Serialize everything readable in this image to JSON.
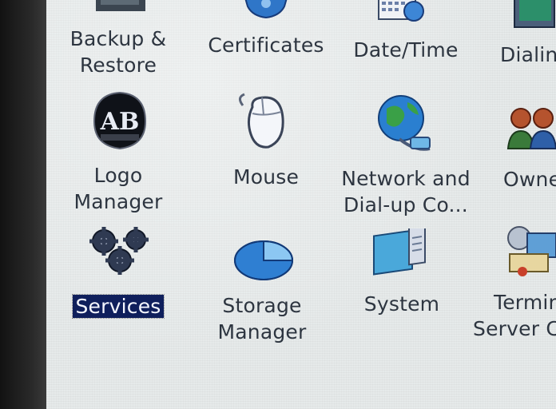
{
  "control_panel": {
    "items": [
      {
        "label_lines": [
          "Backup &",
          "Restore"
        ],
        "icon": "backup-icon"
      },
      {
        "label_lines": [
          "Certificates"
        ],
        "icon": "certificates-icon"
      },
      {
        "label_lines": [
          "Date/Time"
        ],
        "icon": "datetime-icon"
      },
      {
        "label_lines": [
          "Dialing"
        ],
        "icon": "dialing-icon"
      },
      {
        "label_lines": [
          "Logo",
          "Manager"
        ],
        "icon": "logo-manager-icon",
        "logo_text": "AB"
      },
      {
        "label_lines": [
          "Mouse"
        ],
        "icon": "mouse-icon"
      },
      {
        "label_lines": [
          "Network and",
          "Dial-up Co..."
        ],
        "icon": "network-icon"
      },
      {
        "label_lines": [
          "Owne"
        ],
        "icon": "owner-icon"
      },
      {
        "label_lines": [
          "Services"
        ],
        "icon": "services-icon",
        "selected": true
      },
      {
        "label_lines": [
          "Storage",
          "Manager"
        ],
        "icon": "storage-manager-icon"
      },
      {
        "label_lines": [
          "System"
        ],
        "icon": "system-icon"
      },
      {
        "label_lines": [
          "Termin",
          "Server Cl"
        ],
        "icon": "terminal-server-icon"
      }
    ]
  },
  "colors": {
    "background": "#e6eaea",
    "label_text": "#2d3540",
    "selection": "#0f1f5c"
  }
}
